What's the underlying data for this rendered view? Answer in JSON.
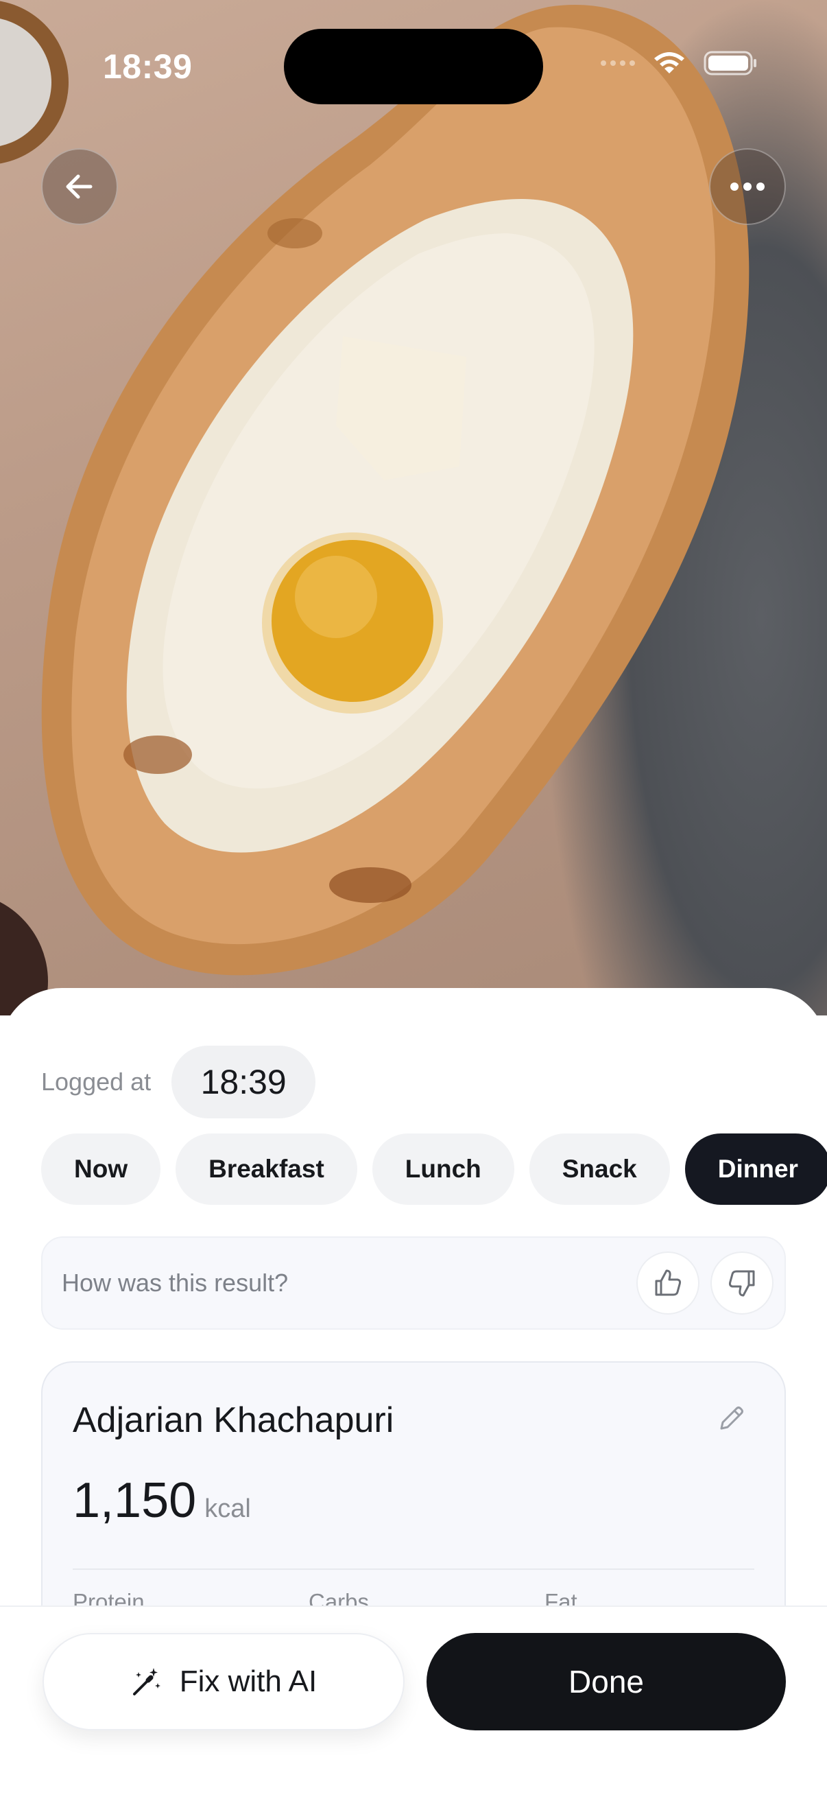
{
  "status_bar": {
    "time": "18:39"
  },
  "photo": {
    "alt": "Adjarian Khachapuri"
  },
  "top_bar": {
    "back_icon": "arrow-left-icon",
    "more_icon": "ellipsis-icon"
  },
  "logged": {
    "label": "Logged at",
    "time": "18:39"
  },
  "meals": [
    {
      "label": "Now",
      "selected": false
    },
    {
      "label": "Breakfast",
      "selected": false
    },
    {
      "label": "Lunch",
      "selected": false
    },
    {
      "label": "Snack",
      "selected": false
    },
    {
      "label": "Dinner",
      "selected": true
    }
  ],
  "feedback": {
    "prompt": "How was this result?",
    "up_icon": "thumbs-up-icon",
    "down_icon": "thumbs-down-icon"
  },
  "food": {
    "name": "Adjarian Khachapuri",
    "calories": "1,150",
    "unit": "kcal",
    "macros": {
      "protein": "Protein",
      "carbs": "Carbs",
      "fat": "Fat"
    }
  },
  "actions": {
    "fix_label": "Fix with AI",
    "done_label": "Done"
  },
  "colors": {
    "primary_dark": "#121418",
    "chip_bg": "#f2f3f5",
    "text_muted": "#8a8d93"
  }
}
